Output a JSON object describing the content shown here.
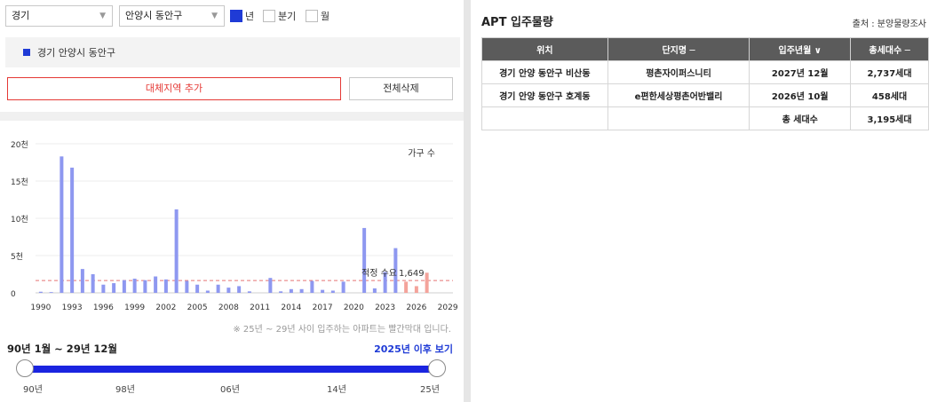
{
  "filters": {
    "province": "경기",
    "district": "안양시 동안구",
    "periods": [
      {
        "label": "년",
        "checked": true
      },
      {
        "label": "분기",
        "checked": false
      },
      {
        "label": "월",
        "checked": false
      }
    ]
  },
  "region": {
    "selected": "경기 안양시 동안구"
  },
  "buttons": {
    "add_region": "대체지역 추가",
    "clear_all": "전체삭제"
  },
  "chart_data": {
    "type": "bar",
    "legend": "가구 수",
    "y_ticks": [
      "0",
      "5천",
      "10천",
      "15천",
      "20천"
    ],
    "ylim": [
      0,
      20000
    ],
    "x_ticks": [
      "1990",
      "1993",
      "1996",
      "1999",
      "2002",
      "2005",
      "2008",
      "2011",
      "2014",
      "2017",
      "2020",
      "2023",
      "2026",
      "2029"
    ],
    "xlim": [
      1989.5,
      2029.5
    ],
    "reference": {
      "label": "적정 수요",
      "value_text": "1,649",
      "value": 1649
    },
    "highlight_from_year": 2025,
    "colors": {
      "past": "#8e98f0",
      "future": "#f4a39b",
      "reference": "#e57373"
    },
    "years": [
      1990,
      1991,
      1992,
      1993,
      1994,
      1995,
      1996,
      1997,
      1998,
      1999,
      2000,
      2001,
      2002,
      2003,
      2004,
      2005,
      2006,
      2007,
      2008,
      2009,
      2010,
      2011,
      2012,
      2013,
      2014,
      2015,
      2016,
      2017,
      2018,
      2019,
      2020,
      2021,
      2022,
      2023,
      2024,
      2025,
      2026,
      2027,
      2028
    ],
    "values": [
      150,
      100,
      18300,
      16800,
      3200,
      2500,
      1100,
      1300,
      1700,
      1900,
      1700,
      2200,
      1800,
      11200,
      1600,
      1100,
      300,
      1100,
      700,
      900,
      200,
      0,
      2000,
      200,
      500,
      500,
      1600,
      400,
      300,
      1500,
      0,
      8700,
      600,
      2800,
      6000,
      1500,
      900,
      2700,
      0
    ]
  },
  "note": "※ 25년 ~ 29년 사이 입주하는 아파트는 빨간막대 입니다.",
  "range": {
    "text": "90년 1월 ~ 29년 12월",
    "after_link": "2025년 이후 보기"
  },
  "slider_labels": [
    "90년",
    "98년",
    "06년",
    "14년",
    "25년"
  ],
  "apt": {
    "title": "APT 입주물량",
    "source": "출처 : 분양물량조사",
    "columns": [
      "위치",
      "단지명 ─",
      "입주년월 ∨",
      "총세대수 ─"
    ],
    "rows": [
      [
        "경기 안양 동안구 비산동",
        "평촌자이퍼스니티",
        "2027년 12월",
        "2,737세대"
      ],
      [
        "경기 안양 동안구 호계동",
        "e편한세상평촌어반밸리",
        "2026년 10월",
        "458세대"
      ]
    ],
    "summary": {
      "label": "총 세대수",
      "value": "3,195세대"
    }
  }
}
